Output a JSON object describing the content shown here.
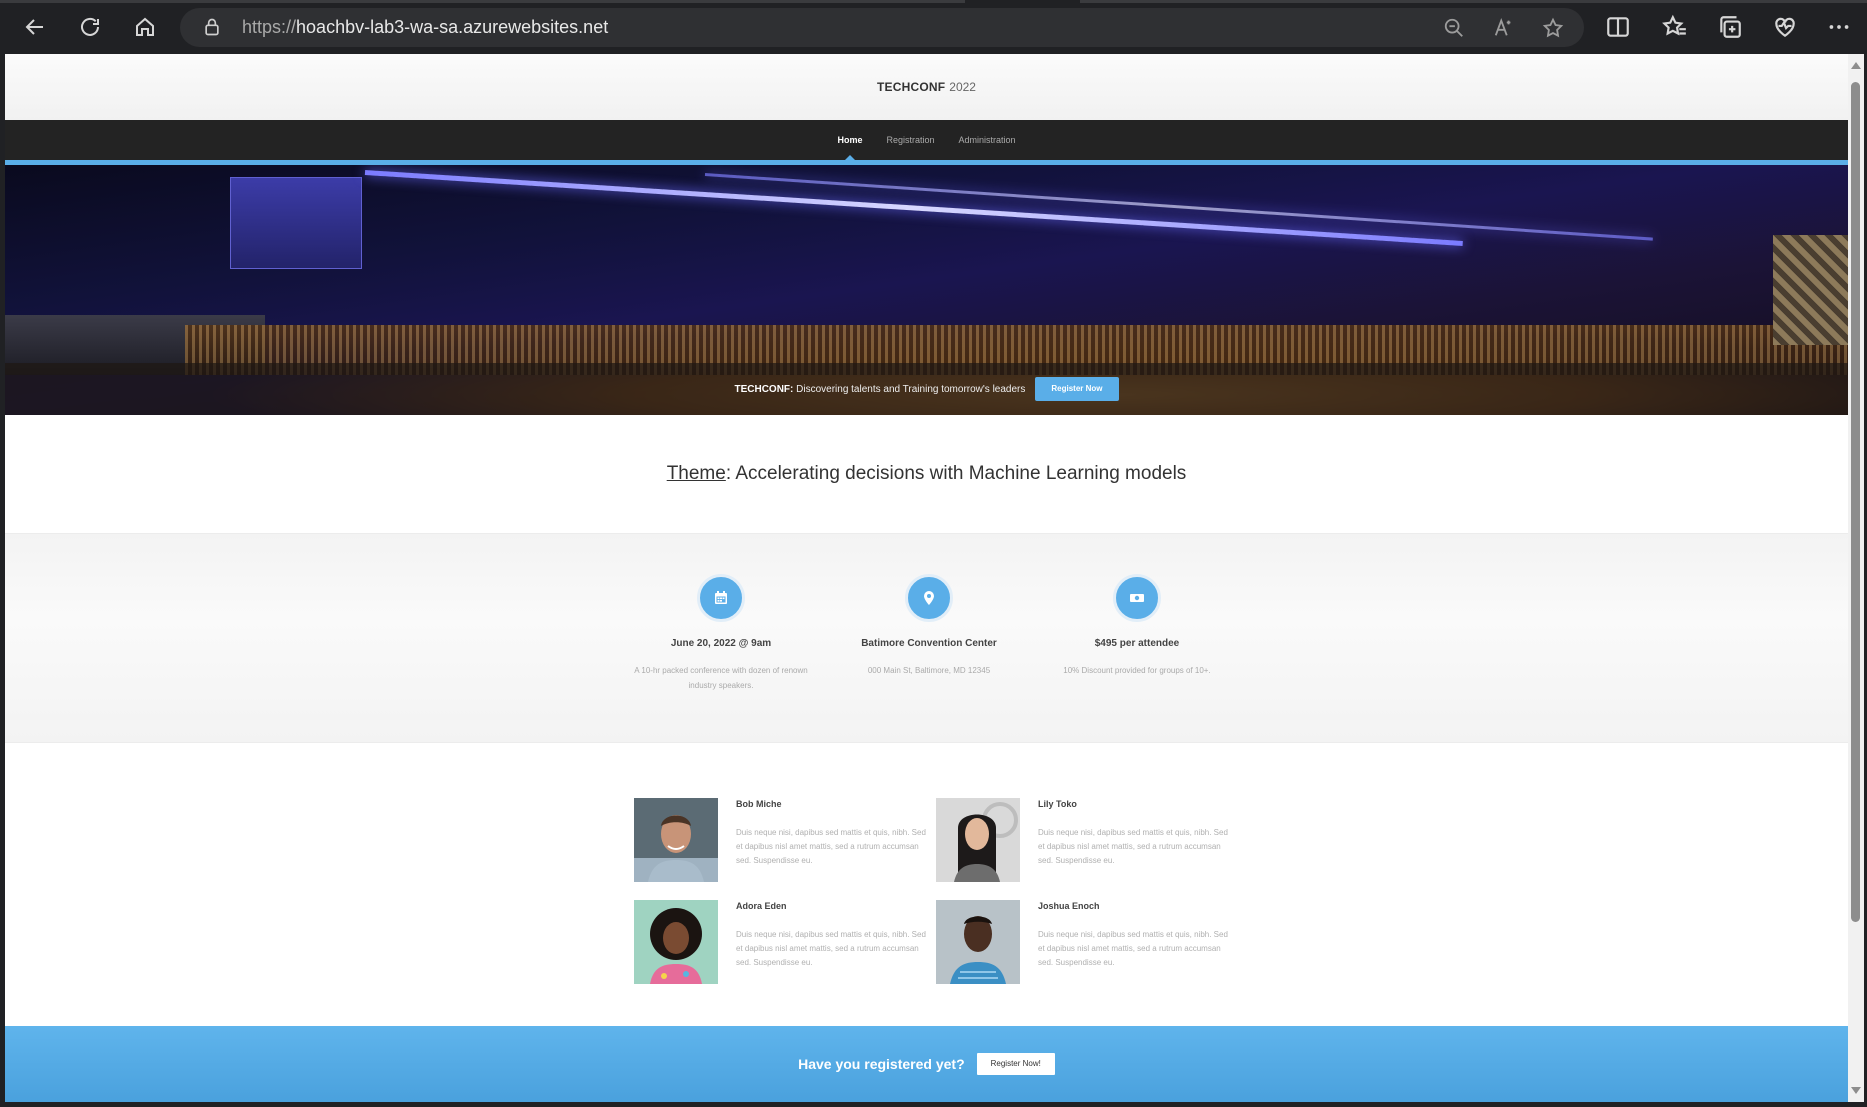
{
  "browser": {
    "url_protocol": "https://",
    "url_host": "hoachbv-lab3-wa-sa.azurewebsites.net"
  },
  "site": {
    "brand": "TECHCONF",
    "year": "2022"
  },
  "nav": {
    "items": [
      {
        "label": "Home",
        "active": true
      },
      {
        "label": "Registration",
        "active": false
      },
      {
        "label": "Administration",
        "active": false
      }
    ]
  },
  "hero": {
    "brand": "TECHCONF:",
    "tagline": " Discovering talents and Training tomorrow's leaders",
    "cta": "Register Now"
  },
  "theme": {
    "label": "Theme",
    "text": ": Accelerating decisions with Machine Learning models"
  },
  "info": [
    {
      "icon": "calendar-icon",
      "title": "June 20, 2022 @ 9am",
      "desc": "A 10-hr packed conference with dozen of renown industry speakers."
    },
    {
      "icon": "location-pin-icon",
      "title": "Batimore Convention Center",
      "desc": "000 Main St, Baltimore, MD 12345"
    },
    {
      "icon": "money-icon",
      "title": "$495 per attendee",
      "desc": "10% Discount provided for groups of 10+."
    }
  ],
  "speakers": [
    {
      "name": "Bob Miche",
      "bio": "Duis neque nisi, dapibus sed mattis et quis, nibh. Sed et dapibus nisl amet mattis, sed a rutrum accumsan sed. Suspendisse eu."
    },
    {
      "name": "Lily Toko",
      "bio": "Duis neque nisi, dapibus sed mattis et quis, nibh. Sed et dapibus nisl amet mattis, sed a rutrum accumsan sed. Suspendisse eu."
    },
    {
      "name": "Adora Eden",
      "bio": "Duis neque nisi, dapibus sed mattis et quis, nibh. Sed et dapibus nisl amet mattis, sed a rutrum accumsan sed. Suspendisse eu."
    },
    {
      "name": "Joshua Enoch",
      "bio": "Duis neque nisi, dapibus sed mattis et quis, nibh. Sed et dapibus nisl amet mattis, sed a rutrum accumsan sed. Suspendisse eu."
    }
  ],
  "cta": {
    "question": "Have you registered yet?",
    "button": "Register Now!"
  },
  "colors": {
    "accent": "#5aaee8",
    "nav_bg": "#232323"
  }
}
